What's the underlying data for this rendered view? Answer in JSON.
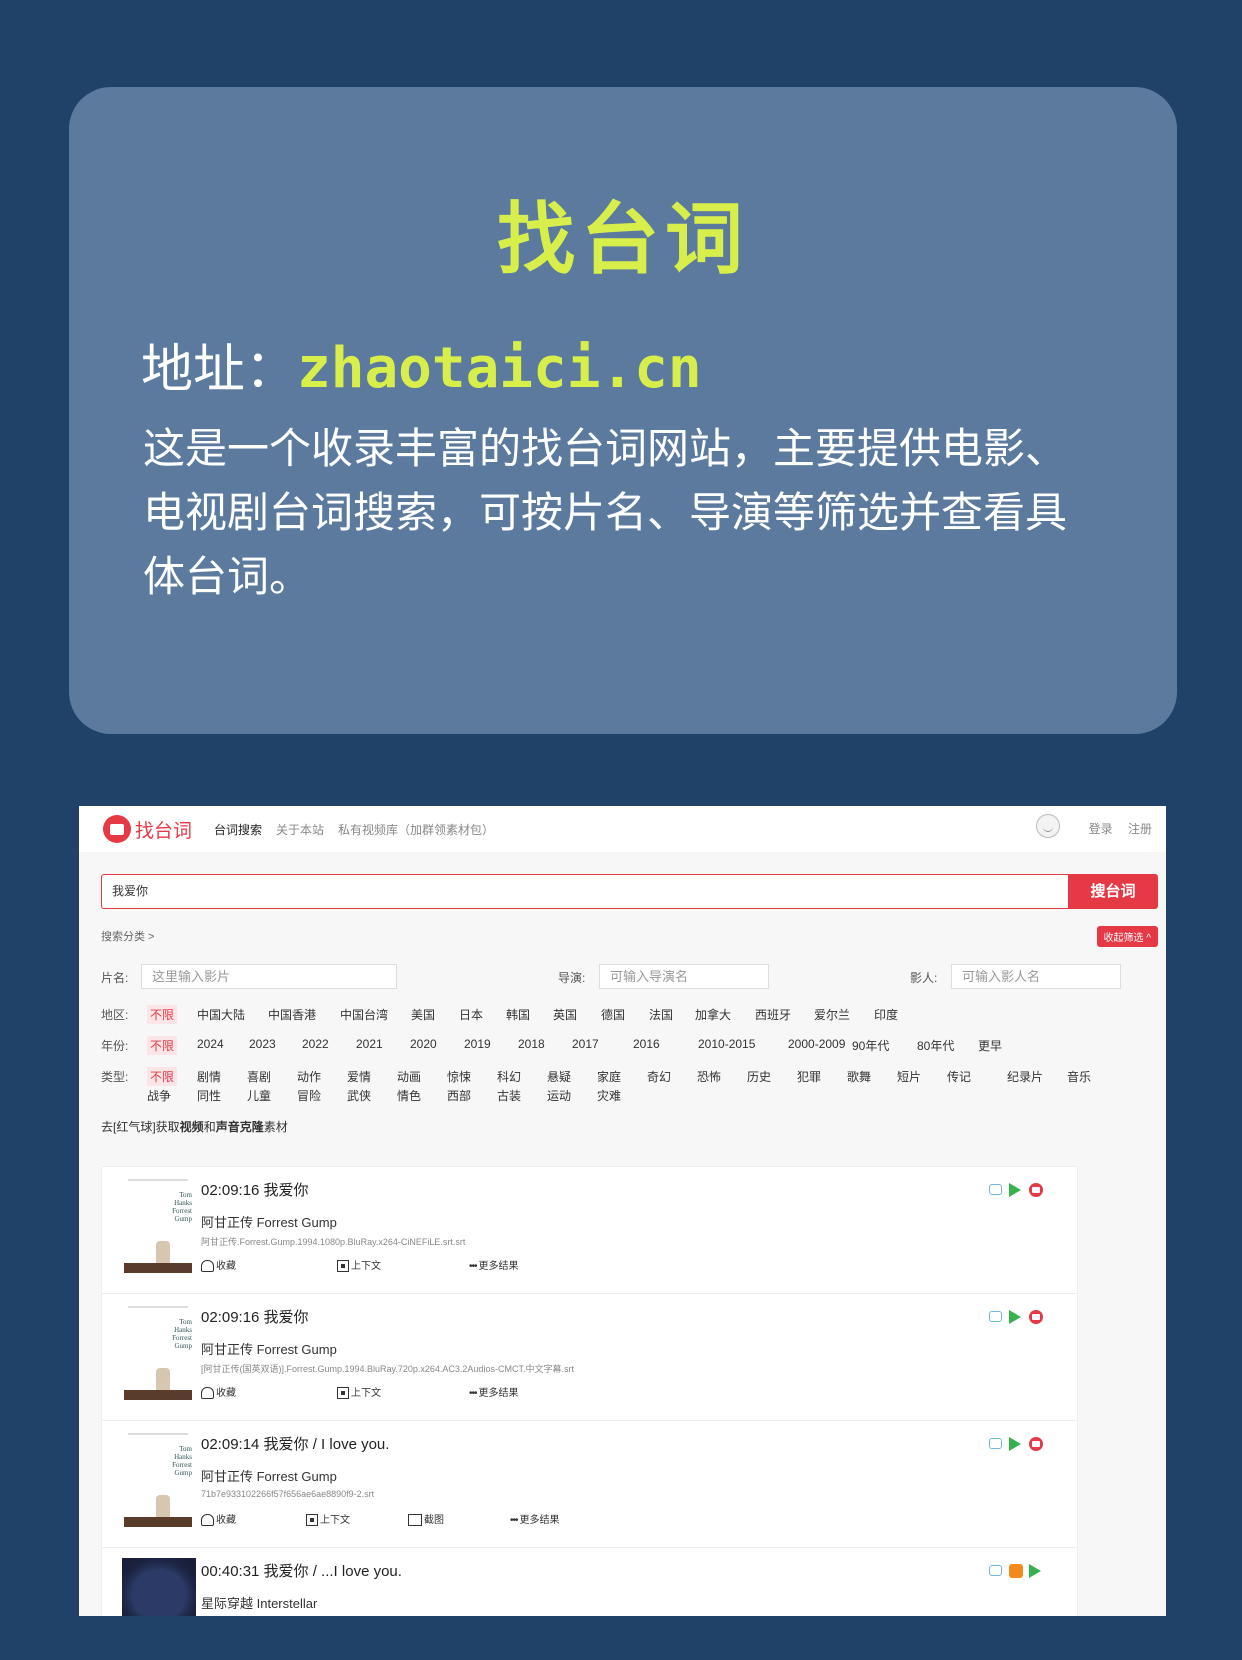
{
  "card": {
    "title": "找台词",
    "address_label": "地址：",
    "address_url": "zhaotaici.cn",
    "description": "这是一个收录丰富的找台词网站，主要提供电影、电视剧台词搜索，可按片名、导演等筛选并查看具体台词。"
  },
  "site": {
    "logo_text": "找台词",
    "nav": [
      "台词搜索",
      "关于本站",
      "私有视频库（加群领素材包）"
    ],
    "login": "登录",
    "register": "注册"
  },
  "search": {
    "query": "我爱你",
    "button": "搜台词"
  },
  "filters": {
    "category_label": "搜索分类 >",
    "collapse_label": "收起筛选 ^",
    "title_label": "片名:",
    "title_placeholder": "这里输入影片",
    "director_label": "导演:",
    "director_placeholder": "可输入导演名",
    "actor_label": "影人:",
    "actor_placeholder": "可输入影人名",
    "region_label": "地区:",
    "regions": [
      "不限",
      "中国大陆",
      "中国香港",
      "中国台湾",
      "美国",
      "日本",
      "韩国",
      "英国",
      "德国",
      "法国",
      "加拿大",
      "西班牙",
      "爱尔兰",
      "印度"
    ],
    "year_label": "年份:",
    "years": [
      "不限",
      "2024",
      "2023",
      "2022",
      "2021",
      "2020",
      "2019",
      "2018",
      "2017",
      "2016",
      "2010-2015",
      "2000-2009",
      "90年代",
      "80年代",
      "更早"
    ],
    "genre_label": "类型:",
    "genres_row1": [
      "不限",
      "剧情",
      "喜剧",
      "动作",
      "爱情",
      "动画",
      "惊悚",
      "科幻",
      "悬疑",
      "家庭",
      "奇幻",
      "恐怖",
      "历史",
      "犯罪",
      "歌舞",
      "短片",
      "传记",
      "纪录片",
      "音乐"
    ],
    "genres_row2": [
      "战争",
      "同性",
      "儿童",
      "冒险",
      "武侠",
      "情色",
      "西部",
      "古装",
      "运动",
      "灾难"
    ]
  },
  "promo": {
    "prefix": "去[红气球]获取",
    "video": "视频",
    "and": "和",
    "voice": "声音克隆",
    "suffix": "素材"
  },
  "results": [
    {
      "timestamp": "02:09:16 我爱你",
      "movie": "阿甘正传 Forrest Gump",
      "file": "阿甘正传.Forrest.Gump.1994.1080p.BluRay.x264-CiNEFiLE.srt.srt",
      "actions": [
        "收藏",
        "上下文",
        "更多结果"
      ],
      "icons": [
        "tv-icon",
        "play-icon",
        "record-icon"
      ]
    },
    {
      "timestamp": "02:09:16 我爱你",
      "movie": "阿甘正传 Forrest Gump",
      "file": "[阿甘正传(国英双语)].Forrest.Gump.1994.BluRay.720p.x264.AC3.2Audios-CMCT.中文字幕.srt",
      "actions": [
        "收藏",
        "上下文",
        "更多结果"
      ],
      "icons": [
        "tv-icon",
        "play-icon",
        "record-icon"
      ]
    },
    {
      "timestamp": "02:09:14 我爱你 / I love you.",
      "movie": "阿甘正传 Forrest Gump",
      "file": "71b7e933102266f57f656ae6ae8890f9-2.srt",
      "actions": [
        "收藏",
        "上下文",
        "截图",
        "更多结果"
      ],
      "icons": [
        "tv-icon",
        "play-icon",
        "record-icon"
      ]
    },
    {
      "timestamp": "00:40:31 我爱你 / ...I love you.",
      "movie": "星际穿越 Interstellar",
      "file": "",
      "actions": [],
      "icons": [
        "tv-icon",
        "mango-icon",
        "play-icon"
      ]
    }
  ],
  "poster": {
    "forrest_title": "Tom Hanks Forrest Gump"
  }
}
